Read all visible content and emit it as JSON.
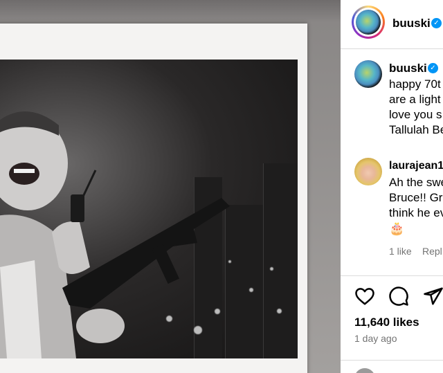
{
  "post": {
    "author": "buuski",
    "caption_lines": [
      "happy 70t",
      "are a light",
      "love you s",
      "Tallulah Be"
    ]
  },
  "comment": {
    "author": "laurajean1",
    "lines": [
      "Ah the swe",
      "Bruce!! Gre",
      "think he ev"
    ],
    "emoji": "🎂",
    "likes": "1 like",
    "reply": "Repl"
  },
  "actions": {
    "like_icon": "heart-icon",
    "comment_icon": "comment-icon",
    "share_icon": "share-icon"
  },
  "stats": {
    "likes": "11,640 likes",
    "time": "1 day ago"
  },
  "colors": {
    "verified": "#0095f6",
    "meta": "#737373",
    "divider": "#dbdbdb"
  }
}
